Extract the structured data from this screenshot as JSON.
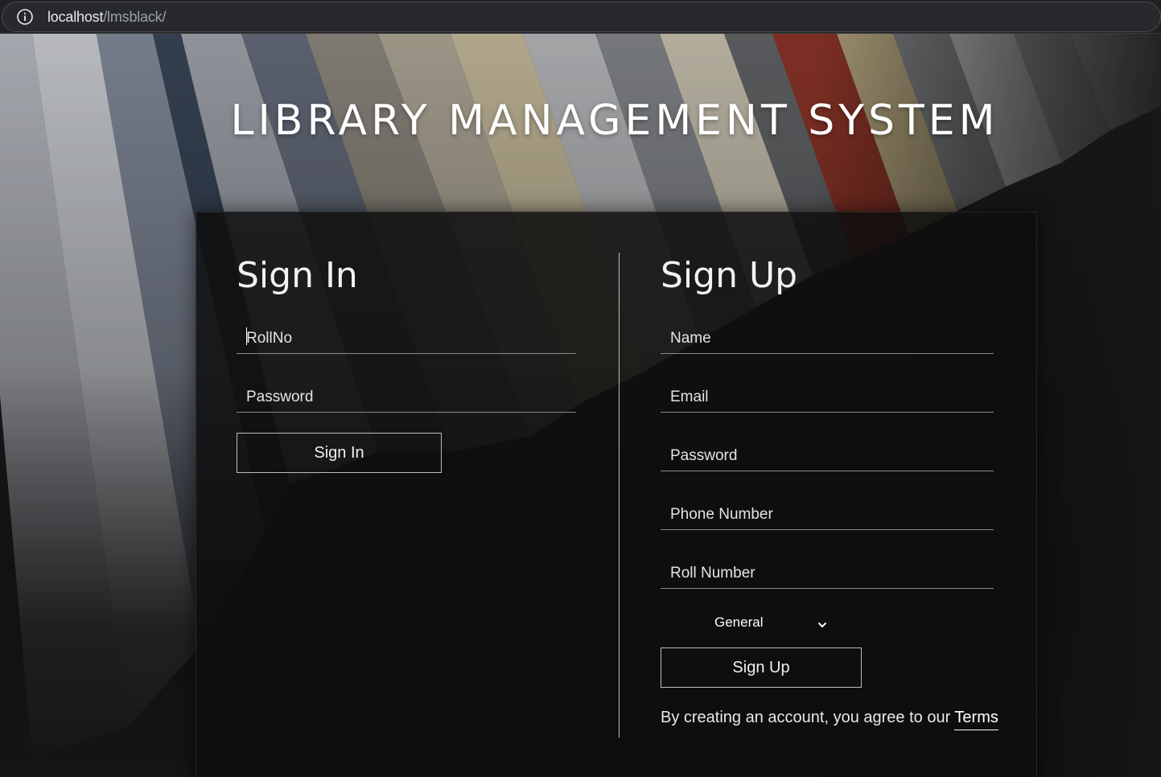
{
  "browser": {
    "url_host": "localhost",
    "url_path": "/lmsblack/"
  },
  "site": {
    "title": "LIBRARY MANAGEMENT SYSTEM"
  },
  "signin": {
    "title": "Sign In",
    "rollno_placeholder": "RollNo",
    "password_placeholder": "Password",
    "button_label": "Sign In"
  },
  "signup": {
    "title": "Sign Up",
    "name_placeholder": "Name",
    "email_placeholder": "Email",
    "password_placeholder": "Password",
    "phone_placeholder": "Phone Number",
    "rollnumber_placeholder": "Roll Number",
    "category_selected": "General",
    "button_label": "Sign Up",
    "terms_text": "By creating an account, you agree to our ",
    "terms_link": "Terms"
  },
  "icons": {
    "info": "info-icon",
    "chevron": "chevron-down-icon"
  },
  "colors": {
    "card_bg": "#0e0e0e",
    "text": "#ffffff",
    "browser_bar": "#202124"
  }
}
